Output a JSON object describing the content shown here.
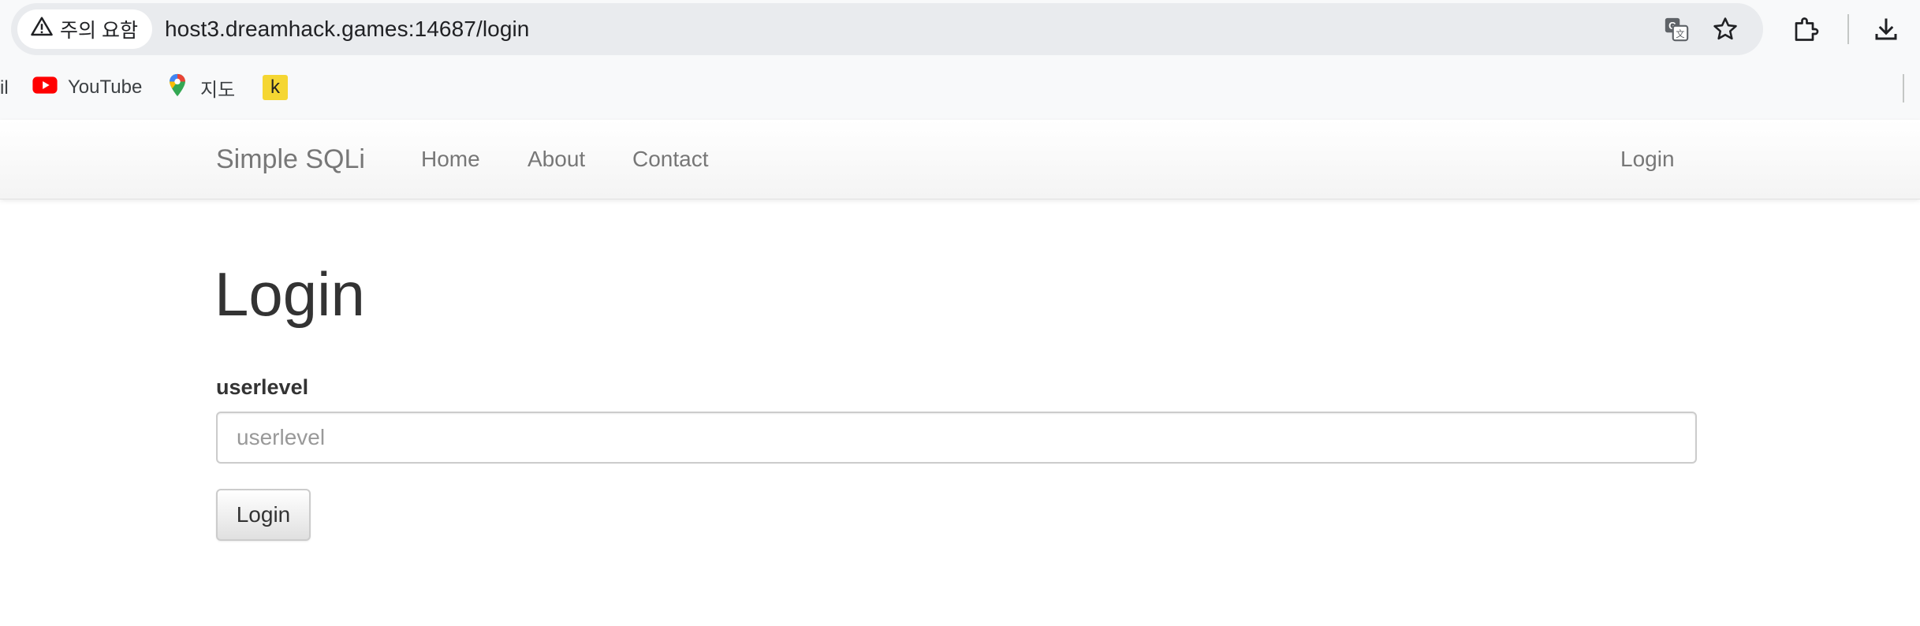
{
  "browser": {
    "security_chip_label": "주의 요함",
    "url": "host3.dreamhack.games:14687/login",
    "icons": [
      "warning-icon",
      "translate-icon",
      "star-icon",
      "extensions-icon",
      "download-icon"
    ]
  },
  "bookmarks": {
    "partial_item": "il",
    "items": [
      {
        "label": "YouTube",
        "icon": "youtube-icon"
      },
      {
        "label": "지도",
        "icon": "maps-pin-icon"
      },
      {
        "label": "",
        "icon": "k-bookmark-icon",
        "glyph": "k"
      }
    ]
  },
  "navbar": {
    "brand": "Simple SQLi",
    "links": [
      "Home",
      "About",
      "Contact"
    ],
    "right_link": "Login"
  },
  "main": {
    "title": "Login",
    "field_label": "userlevel",
    "field_placeholder": "userlevel",
    "field_value": "",
    "submit_label": "Login"
  }
}
